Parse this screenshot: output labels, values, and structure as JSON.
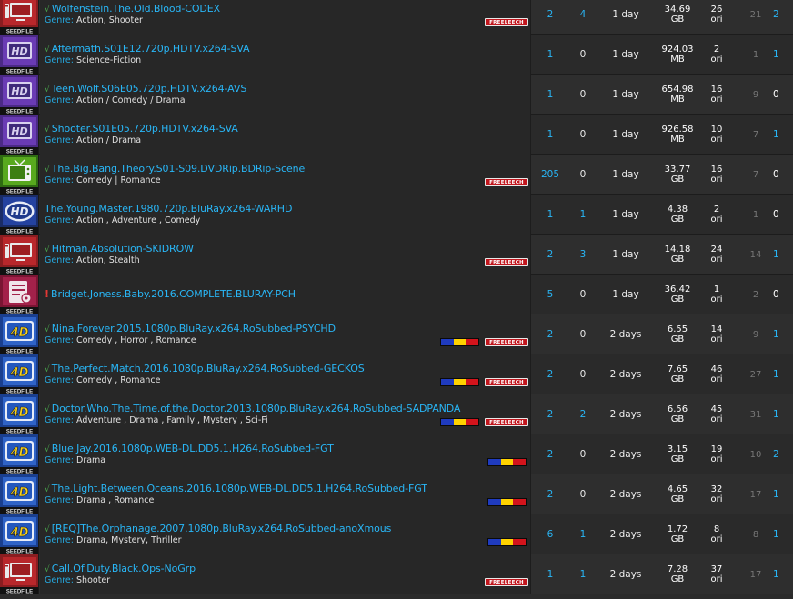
{
  "colors": {
    "link": "#29b6f6",
    "genre_label": "#26a9e0",
    "freeleech_bg": "#c0161d",
    "check": "#4caf50",
    "warning": "#e53935"
  },
  "labels": {
    "genre": "Genre:",
    "freeleech": "FREELEECH",
    "seedfile": "SEEDFILE"
  },
  "torrents": [
    {
      "category": "PC",
      "cat_icon": "monitor-icon",
      "mark": "√",
      "name": "Wolfenstein.The.Old.Blood-CODEX",
      "genre": "Action, Shooter",
      "flag": false,
      "freeleech": true,
      "seeders": "2",
      "leechers": "4",
      "added": "1 day",
      "size_value": "34.69",
      "size_unit": "GB",
      "snatched": "26",
      "snatched_unit": "ori",
      "uploaded": "21",
      "downloaded": "2"
    },
    {
      "category": "HD",
      "cat_icon": "hd-tv-icon",
      "mark": "√",
      "name": "Aftermath.S01E12.720p.HDTV.x264-SVA",
      "genre": "Science-Fiction",
      "flag": false,
      "freeleech": false,
      "seeders": "1",
      "leechers": "0",
      "added": "1 day",
      "size_value": "924.03",
      "size_unit": "MB",
      "snatched": "2",
      "snatched_unit": "ori",
      "uploaded": "1",
      "downloaded": "1"
    },
    {
      "category": "HD",
      "cat_icon": "hd-tv-icon",
      "mark": "√",
      "name": "Teen.Wolf.S06E05.720p.HDTV.x264-AVS",
      "genre": "Action / Comedy / Drama",
      "flag": false,
      "freeleech": false,
      "seeders": "1",
      "leechers": "0",
      "added": "1 day",
      "size_value": "654.98",
      "size_unit": "MB",
      "snatched": "16",
      "snatched_unit": "ori",
      "uploaded": "9",
      "downloaded": "0"
    },
    {
      "category": "HD",
      "cat_icon": "hd-tv-icon",
      "mark": "√",
      "name": "Shooter.S01E05.720p.HDTV.x264-SVA",
      "genre": "Action / Drama",
      "flag": false,
      "freeleech": false,
      "seeders": "1",
      "leechers": "0",
      "added": "1 day",
      "size_value": "926.58",
      "size_unit": "MB",
      "snatched": "10",
      "snatched_unit": "ori",
      "uploaded": "7",
      "downloaded": "1"
    },
    {
      "category": "TV",
      "cat_icon": "tv-icon",
      "mark": "√",
      "name": "The.Big.Bang.Theory.S01-S09.DVDRip.BDRip-Scene",
      "genre": "Comedy | Romance",
      "flag": false,
      "freeleech": true,
      "seeders": "205",
      "leechers": "0",
      "added": "1 day",
      "size_value": "33.77",
      "size_unit": "GB",
      "snatched": "16",
      "snatched_unit": "ori",
      "uploaded": "7",
      "downloaded": "0"
    },
    {
      "category": "HD Movie",
      "cat_icon": "hd-disc-icon",
      "mark": "",
      "name": "The.Young.Master.1980.720p.BluRay.x264-WARHD",
      "genre": "Action , Adventure , Comedy",
      "flag": false,
      "freeleech": false,
      "seeders": "1",
      "leechers": "1",
      "added": "1 day",
      "size_value": "4.38",
      "size_unit": "GB",
      "snatched": "2",
      "snatched_unit": "ori",
      "uploaded": "1",
      "downloaded": "0"
    },
    {
      "category": "PC",
      "cat_icon": "monitor-icon",
      "mark": "√",
      "name": "Hitman.Absolution-SKIDROW",
      "genre": "Action, Stealth",
      "flag": false,
      "freeleech": true,
      "seeders": "2",
      "leechers": "3",
      "added": "1 day",
      "size_value": "14.18",
      "size_unit": "GB",
      "snatched": "24",
      "snatched_unit": "ori",
      "uploaded": "14",
      "downloaded": "1"
    },
    {
      "category": "Blu-Ray",
      "cat_icon": "bluray-icon",
      "mark": "!",
      "name": "Bridget.Joness.Baby.2016.COMPLETE.BLURAY-PCH",
      "genre": "",
      "flag": false,
      "freeleech": false,
      "seeders": "5",
      "leechers": "0",
      "added": "1 day",
      "size_value": "36.42",
      "size_unit": "GB",
      "snatched": "1",
      "snatched_unit": "ori",
      "uploaded": "2",
      "downloaded": "0"
    },
    {
      "category": "4D",
      "cat_icon": "4d-icon",
      "mark": "√",
      "name": "Nina.Forever.2015.1080p.BluRay.x264.RoSubbed-PSYCHD",
      "genre": "Comedy , Horror , Romance",
      "flag": true,
      "freeleech": true,
      "seeders": "2",
      "leechers": "0",
      "added": "2 days",
      "size_value": "6.55",
      "size_unit": "GB",
      "snatched": "14",
      "snatched_unit": "ori",
      "uploaded": "9",
      "downloaded": "1"
    },
    {
      "category": "4D",
      "cat_icon": "4d-icon",
      "mark": "√",
      "name": "The.Perfect.Match.2016.1080p.BluRay.x264.RoSubbed-GECKOS",
      "genre": "Comedy , Romance",
      "flag": true,
      "freeleech": true,
      "seeders": "2",
      "leechers": "0",
      "added": "2 days",
      "size_value": "7.65",
      "size_unit": "GB",
      "snatched": "46",
      "snatched_unit": "ori",
      "uploaded": "27",
      "downloaded": "1"
    },
    {
      "category": "4D",
      "cat_icon": "4d-icon",
      "mark": "√",
      "name": "Doctor.Who.The.Time.of.the.Doctor.2013.1080p.BluRay.x264.RoSubbed-SADPANDA",
      "genre": "Adventure , Drama , Family , Mystery , Sci-Fi",
      "flag": true,
      "freeleech": true,
      "seeders": "2",
      "leechers": "2",
      "added": "2 days",
      "size_value": "6.56",
      "size_unit": "GB",
      "snatched": "45",
      "snatched_unit": "ori",
      "uploaded": "31",
      "downloaded": "1"
    },
    {
      "category": "4D",
      "cat_icon": "4d-icon",
      "mark": "√",
      "name": "Blue.Jay.2016.1080p.WEB-DL.DD5.1.H264.RoSubbed-FGT",
      "genre": "Drama",
      "flag": true,
      "freeleech": false,
      "seeders": "2",
      "leechers": "0",
      "added": "2 days",
      "size_value": "3.15",
      "size_unit": "GB",
      "snatched": "19",
      "snatched_unit": "ori",
      "uploaded": "10",
      "downloaded": "2"
    },
    {
      "category": "4D",
      "cat_icon": "4d-icon",
      "mark": "√",
      "name": "The.Light.Between.Oceans.2016.1080p.WEB-DL.DD5.1.H264.RoSubbed-FGT",
      "genre": "Drama , Romance",
      "flag": true,
      "freeleech": false,
      "seeders": "2",
      "leechers": "0",
      "added": "2 days",
      "size_value": "4.65",
      "size_unit": "GB",
      "snatched": "32",
      "snatched_unit": "ori",
      "uploaded": "17",
      "downloaded": "1"
    },
    {
      "category": "4D",
      "cat_icon": "4d-icon",
      "mark": "√",
      "name": "[REQ]The.Orphanage.2007.1080p.BluRay.x264.RoSubbed-anoXmous",
      "genre": "Drama, Mystery, Thriller",
      "flag": true,
      "freeleech": false,
      "seeders": "6",
      "leechers": "1",
      "added": "2 days",
      "size_value": "1.72",
      "size_unit": "GB",
      "snatched": "8",
      "snatched_unit": "ori",
      "uploaded": "8",
      "downloaded": "1"
    },
    {
      "category": "PC",
      "cat_icon": "monitor-icon",
      "mark": "√",
      "name": "Call.Of.Duty.Black.Ops-NoGrp",
      "genre": "Shooter",
      "flag": false,
      "freeleech": true,
      "seeders": "1",
      "leechers": "1",
      "added": "2 days",
      "size_value": "7.28",
      "size_unit": "GB",
      "snatched": "37",
      "snatched_unit": "ori",
      "uploaded": "17",
      "downloaded": "1"
    }
  ]
}
